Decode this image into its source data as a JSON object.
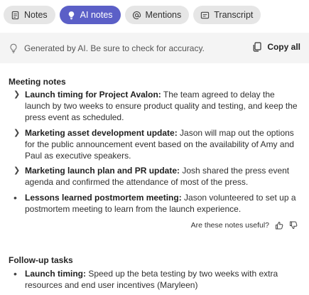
{
  "tabs": [
    {
      "label": "Notes",
      "icon": "notes-icon",
      "active": false
    },
    {
      "label": "AI notes",
      "icon": "lightbulb-icon",
      "active": true
    },
    {
      "label": "Mentions",
      "icon": "at-icon",
      "active": false
    },
    {
      "label": "Transcript",
      "icon": "transcript-icon",
      "active": false
    }
  ],
  "banner": {
    "disclaimer": "Generated by AI. Be sure to check for accuracy.",
    "copy_label": "Copy all"
  },
  "meeting_notes": {
    "title": "Meeting notes",
    "items": [
      {
        "heading": "Launch timing for Project Avalon:",
        "body": " The team agreed to delay the launch by two weeks to ensure product quality and testing, and keep the press event as scheduled."
      },
      {
        "heading": "Marketing asset development update:",
        "body": " Jason will map out the options for the public announcement event based on the availability of Amy and Paul as executive speakers."
      },
      {
        "heading": "Marketing launch plan and PR update:",
        "body": " Josh shared the press event agenda and confirmed the attendance of most of the press."
      },
      {
        "heading": "Lessons learned postmortem meeting:",
        "body": " Jason volunteered to set up a postmortem meeting to learn from the launch experience."
      }
    ]
  },
  "feedback": {
    "question": "Are these notes useful?"
  },
  "follow_up": {
    "title": "Follow-up tasks",
    "items": [
      {
        "heading": "Launch timing:",
        "body": " Speed up the beta testing by two weeks with extra resources and end user incentives (Maryleen)"
      }
    ]
  },
  "colors": {
    "accent": "#5b5fc7",
    "banner_bg": "#f4f4f4",
    "tab_bg": "#e6e6e6"
  }
}
